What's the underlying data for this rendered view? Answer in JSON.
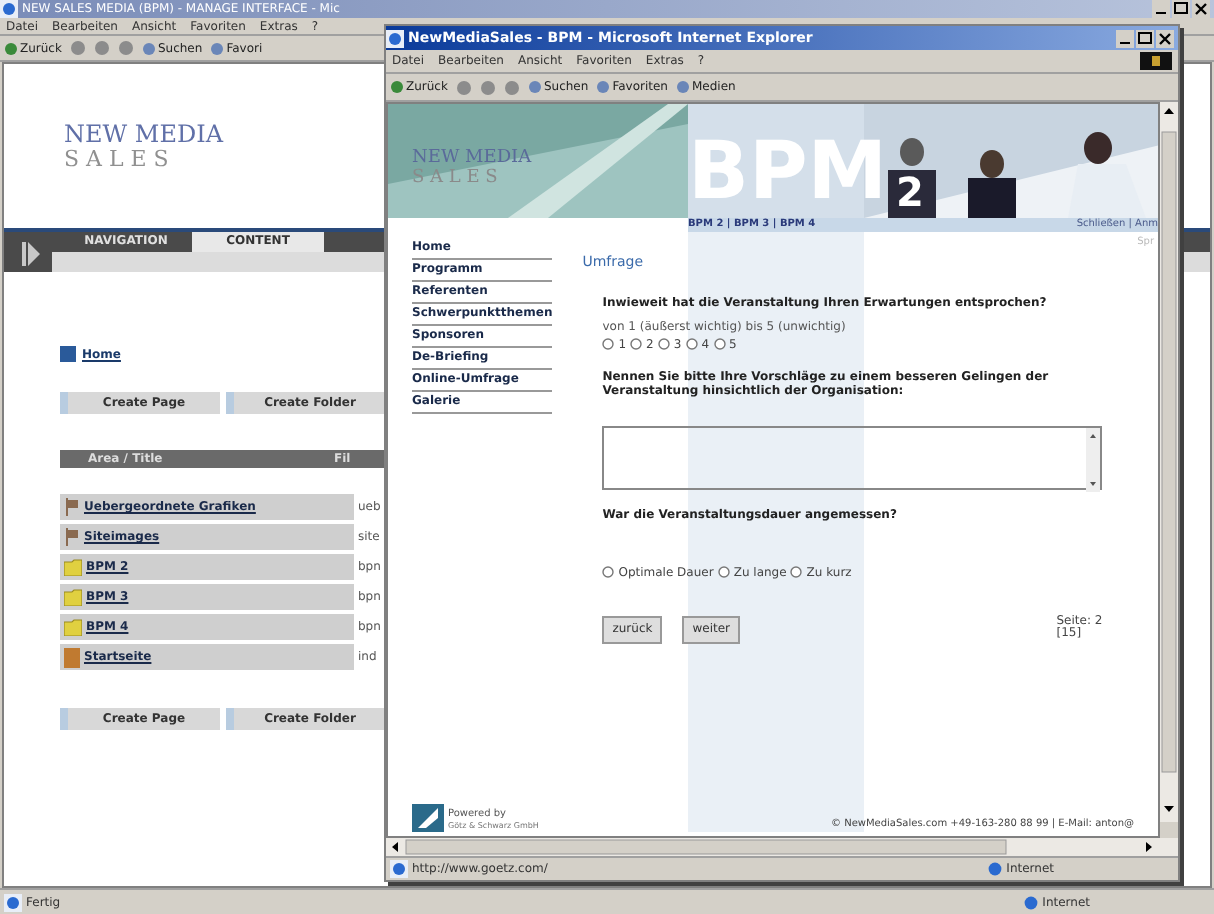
{
  "back_window": {
    "title": "NEW SALES MEDIA (BPM) - MANAGE INTERFACE - Mic",
    "menu": [
      "Datei",
      "Bearbeiten",
      "Ansicht",
      "Favoriten",
      "Extras",
      "?"
    ],
    "toolbar": [
      "Zurück",
      "Suchen",
      "Favori"
    ],
    "logo": [
      "NEW MEDIA",
      "S A L E S"
    ],
    "tabs": [
      {
        "label": "NAVIGATION",
        "selected": false
      },
      {
        "label": "CONTENT",
        "selected": true
      }
    ],
    "home_link": "Home",
    "buttons_top": [
      "Create Page",
      "Create Folder"
    ],
    "table": {
      "columns": [
        "Area / Title",
        "Fil"
      ],
      "rows": [
        {
          "kind": "area",
          "title": "Uebergeordnete Grafiken",
          "file": "ueb"
        },
        {
          "kind": "area",
          "title": "Siteimages",
          "file": "site"
        },
        {
          "kind": "folder",
          "title": "BPM 2",
          "file": "bpn"
        },
        {
          "kind": "folder",
          "title": "BPM 3",
          "file": "bpn"
        },
        {
          "kind": "folder",
          "title": "BPM 4",
          "file": "bpn"
        },
        {
          "kind": "page",
          "title": "Startseite",
          "file": "ind"
        }
      ]
    },
    "buttons_bottom": [
      "Create Page",
      "Create Folder"
    ],
    "status_bar": {
      "text": "Fertig",
      "zone": "Internet"
    }
  },
  "front_window": {
    "title": "NewMediaSales - BPM - Microsoft Internet Explorer",
    "menu": [
      "Datei",
      "Bearbeiten",
      "Ansicht",
      "Favoriten",
      "Extras",
      "?"
    ],
    "toolbar": [
      "Zurück",
      "Suchen",
      "Favoriten",
      "Medien"
    ],
    "banner": {
      "logo": [
        "NEW MEDIA",
        "S A L E S"
      ],
      "brand": "BPM",
      "brand_sub": "2",
      "links": "BPM 2 | BPM 3 | BPM 4",
      "links_right": "Schließen | Anm"
    },
    "side_menu": [
      "Home",
      "Programm",
      "Referenten",
      "Schwerpunktthemen",
      "Sponsoren",
      "De-Briefing",
      "Online-Umfrage",
      "Galerie"
    ],
    "corner_text": "Spr",
    "heading": "Umfrage",
    "questions": [
      {
        "kind": "rating",
        "text": "Inwieweit hat die Veranstaltung Ihren Erwartungen entsprochen?",
        "hint": "von 1 (äußerst wichtig) bis 5 (unwichtig)",
        "options": [
          {
            "label": "1",
            "selected": false
          },
          {
            "label": "2",
            "selected": false
          },
          {
            "label": "3",
            "selected": false
          },
          {
            "label": "4",
            "selected": false
          },
          {
            "label": "5",
            "selected": false
          }
        ]
      },
      {
        "kind": "text",
        "text": "Nennen Sie bitte Ihre Vorschläge zu einem besseren Gelingen der Veranstaltung hinsichtlich der Organisation:"
      },
      {
        "kind": "choice",
        "text": "War die Veranstaltungsdauer angemessen?",
        "options": [
          {
            "label": "Optimale Dauer",
            "selected": false
          },
          {
            "label": "Zu lange",
            "selected": false
          },
          {
            "label": "Zu kurz",
            "selected": false
          }
        ]
      }
    ],
    "buttons": [
      "zurück",
      "weiter"
    ],
    "page_info": [
      "Seite: 2",
      "[15]"
    ],
    "footer": {
      "powered_by": "Powered by",
      "company": "Götz & Schwarz GmbH",
      "copyright": "© NewMediaSales.com +49-163-280 88 99 | E-Mail: anton@"
    },
    "status_bar": {
      "url": "http://www.goetz.com/",
      "zone": "Internet"
    }
  }
}
